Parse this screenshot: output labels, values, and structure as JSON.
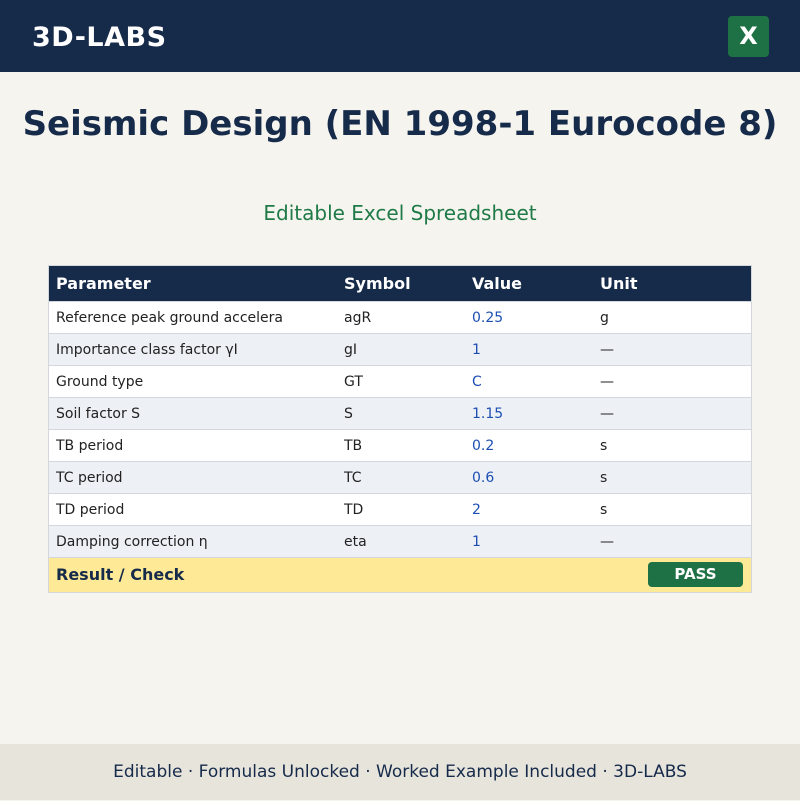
{
  "header": {
    "brand": "3D-LABS",
    "excel_icon_letter": "X"
  },
  "title": "Seismic Design (EN 1998-1 Eurocode 8)",
  "subtitle": "Editable Excel Spreadsheet",
  "table": {
    "columns": [
      "Parameter",
      "Symbol",
      "Value",
      "Unit"
    ],
    "rows": [
      {
        "parameter": "Reference peak ground accelera",
        "symbol": "agR",
        "value": "0.25",
        "unit": "g"
      },
      {
        "parameter": "Importance class factor γI",
        "symbol": "gI",
        "value": "1",
        "unit": "—"
      },
      {
        "parameter": "Ground type",
        "symbol": "GT",
        "value": "C",
        "unit": "—"
      },
      {
        "parameter": "Soil factor S",
        "symbol": "S",
        "value": "1.15",
        "unit": "—"
      },
      {
        "parameter": "TB period",
        "symbol": "TB",
        "value": "0.2",
        "unit": "s"
      },
      {
        "parameter": "TC period",
        "symbol": "TC",
        "value": "0.6",
        "unit": "s"
      },
      {
        "parameter": "TD period",
        "symbol": "TD",
        "value": "2",
        "unit": "s"
      },
      {
        "parameter": "Damping correction η",
        "symbol": "eta",
        "value": "1",
        "unit": "—"
      }
    ],
    "result_label": "Result / Check",
    "result_status": "PASS"
  },
  "footer": "Editable  ·  Formulas Unlocked  ·  Worked Example Included  ·  3D-LABS",
  "colors": {
    "navy": "#162a4a",
    "excel_green": "#1e7145",
    "subtitle_green": "#1f7a47",
    "value_blue": "#1d4fb3",
    "result_yellow": "#fde996"
  }
}
